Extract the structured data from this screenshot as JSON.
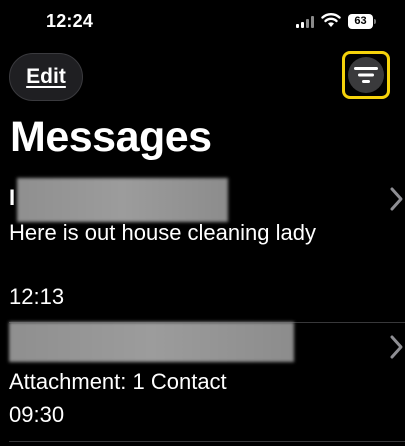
{
  "status": {
    "time": "12:24",
    "battery": "63"
  },
  "header": {
    "edit_label": "Edit",
    "filter_icon": "filter-icon",
    "title": "Messages"
  },
  "conversations": [
    {
      "name_initial": "I",
      "name_redacted": true,
      "preview": "Here is out house cleaning lady",
      "time": "12:13"
    },
    {
      "name_redacted": true,
      "preview": "Attachment: 1 Contact",
      "time": "09:30"
    }
  ],
  "colors": {
    "background": "#000000",
    "highlight": "#f5d20b",
    "divider": "#38383a",
    "button": "#3a3a3c"
  }
}
